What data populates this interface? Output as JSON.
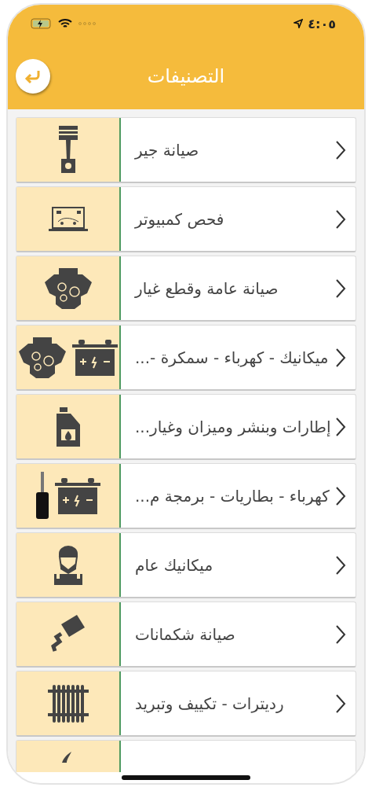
{
  "status_bar": {
    "time": "٤:٠٥"
  },
  "header": {
    "title": "التصنيفات"
  },
  "categories": [
    {
      "label": "صيانة جير",
      "icons": [
        {
          "kind": "piston"
        }
      ]
    },
    {
      "label": "فحص كمبيوتر",
      "icons": [
        {
          "kind": "laptop"
        }
      ]
    },
    {
      "label": "صيانة عامة وقطع غيار",
      "icons": [
        {
          "kind": "engine"
        }
      ]
    },
    {
      "label": "ميكانيك - كهرباء - سمكرة -...",
      "icons": [
        {
          "kind": "engine"
        },
        {
          "kind": "battery"
        }
      ]
    },
    {
      "label": "إطارات وبنشر وميزان وغيار...",
      "icons": [
        {
          "kind": "oil"
        }
      ]
    },
    {
      "label": "كهرباء - بطاريات - برمجة م...",
      "icons": [
        {
          "kind": "key"
        },
        {
          "kind": "battery"
        }
      ]
    },
    {
      "label": "ميكانيك عام",
      "icons": [
        {
          "kind": "mechanic"
        }
      ]
    },
    {
      "label": "صيانة شكمانات",
      "icons": [
        {
          "kind": "exhaust"
        }
      ]
    },
    {
      "label": "رديترات - تكييف وتبريد",
      "icons": [
        {
          "kind": "radiator"
        }
      ]
    },
    {
      "icons": [
        {
          "kind": "hook"
        }
      ]
    }
  ]
}
